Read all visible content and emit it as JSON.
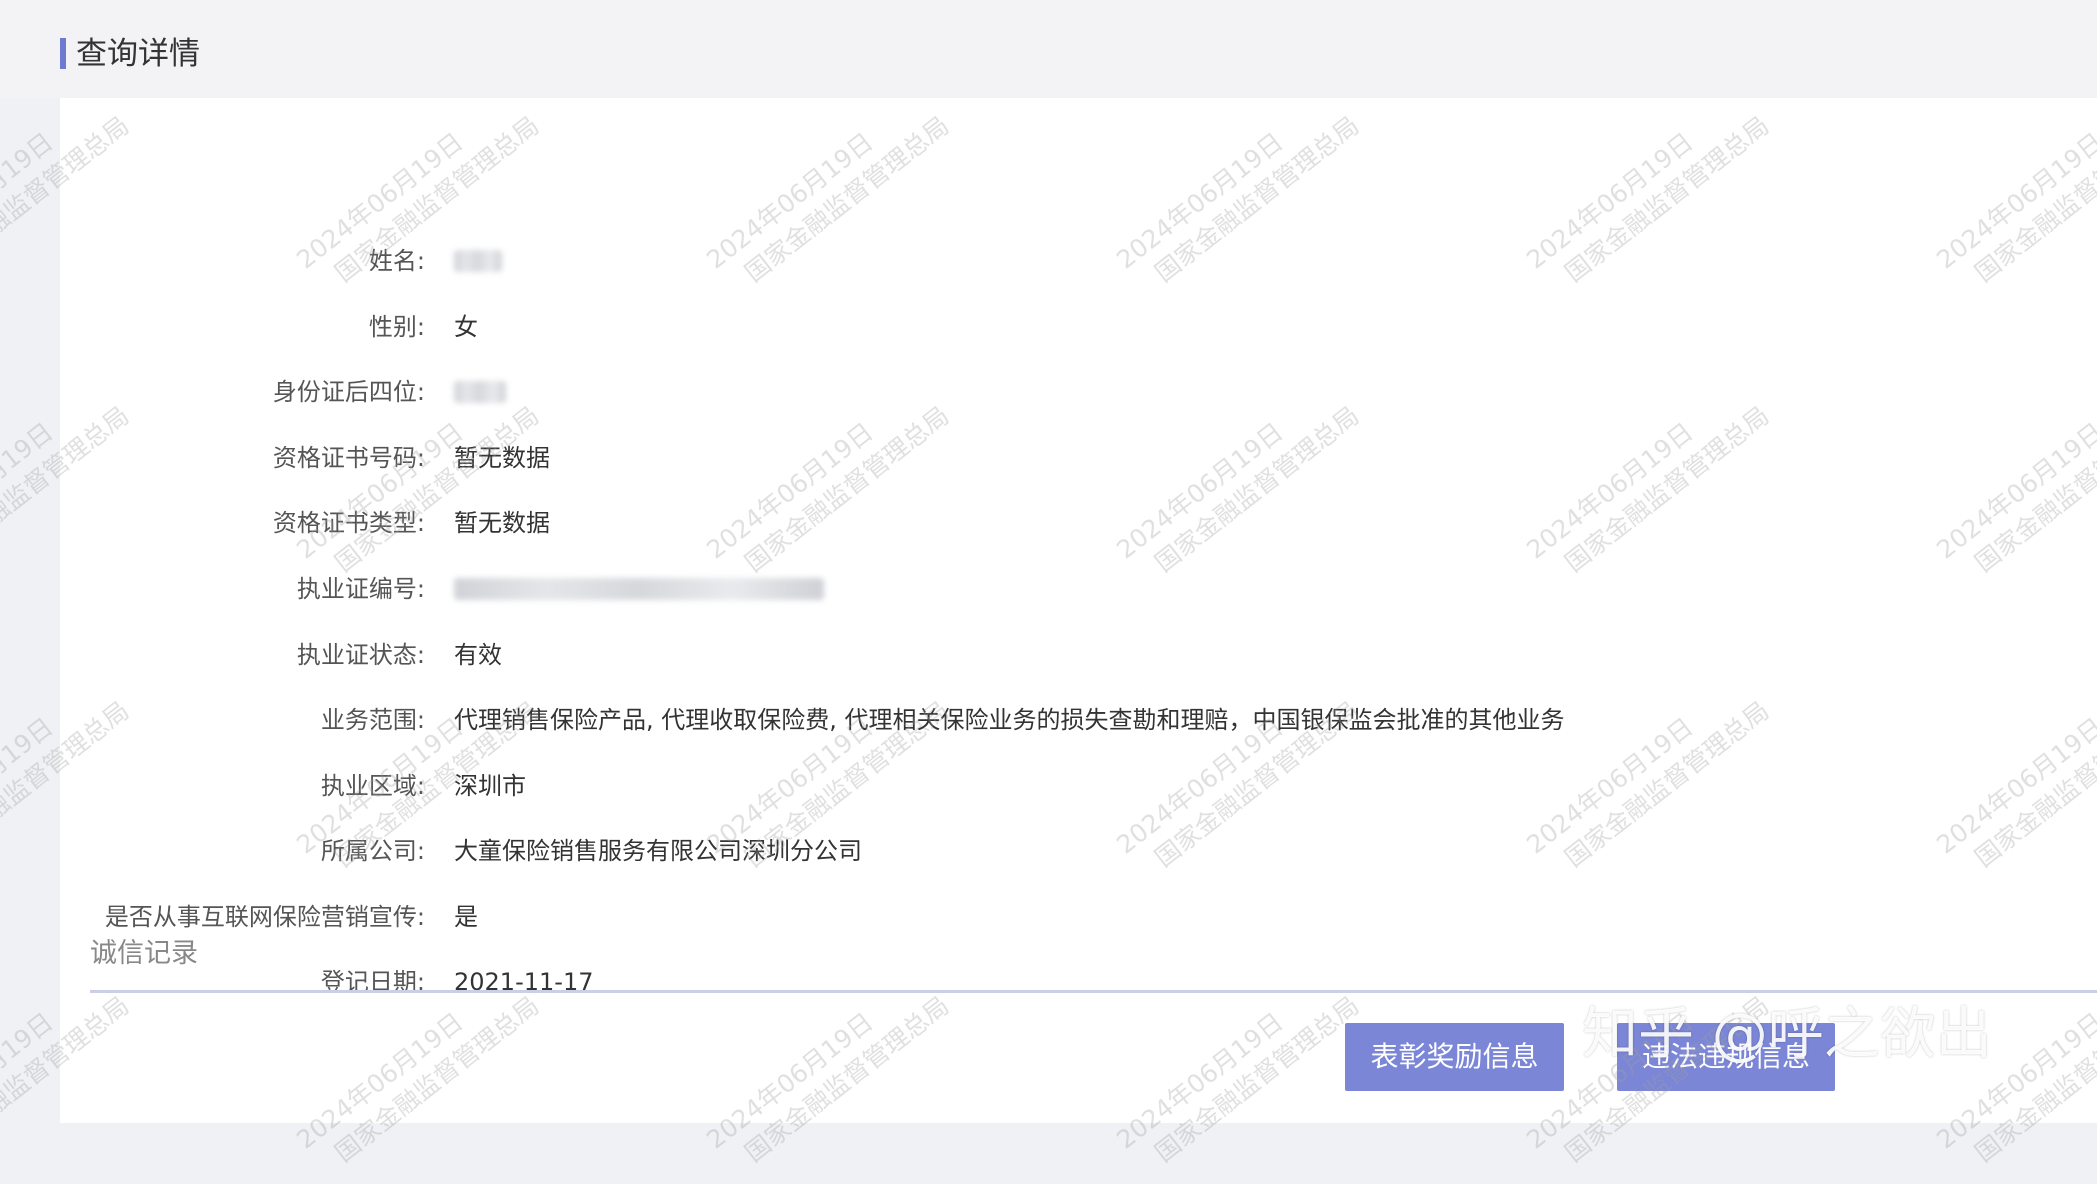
{
  "header": {
    "title": "查询详情"
  },
  "fields": [
    {
      "label": "姓名:",
      "value": "",
      "blurred": true
    },
    {
      "label": "性别:",
      "value": "女",
      "blurred": false
    },
    {
      "label": "身份证后四位:",
      "value": "",
      "blurred": true
    },
    {
      "label": "资格证书号码:",
      "value": "暂无数据",
      "blurred": false
    },
    {
      "label": "资格证书类型:",
      "value": "暂无数据",
      "blurred": false
    },
    {
      "label": "执业证编号:",
      "value": "",
      "blurred": true
    },
    {
      "label": "执业证状态:",
      "value": "有效",
      "blurred": false
    },
    {
      "label": "业务范围:",
      "value": "代理销售保险产品, 代理收取保险费, 代理相关保险业务的损失查勘和理赔，中国银保监会批准的其他业务",
      "blurred": false
    },
    {
      "label": "执业区域:",
      "value": "深圳市",
      "blurred": false
    },
    {
      "label": "所属公司:",
      "value": "大童保险销售服务有限公司深圳分公司",
      "blurred": false
    },
    {
      "label": "是否从事互联网保险营销宣传:",
      "value": "是",
      "blurred": false
    },
    {
      "label": "登记日期:",
      "value": "2021-11-17",
      "blurred": false
    }
  ],
  "credit": {
    "title": "诚信记录",
    "buttons": {
      "award_label": "表彰奖励信息",
      "violation_label": "违法违规信息"
    }
  },
  "watermark": {
    "line1": "2024年06月19日",
    "line2": "国家金融监督管理总局"
  },
  "overlay": {
    "text": "知乎 @呼之欲出"
  },
  "colors": {
    "accent": "#6e7ad0",
    "button": "#7b86d6",
    "background": "#f0f1f4"
  }
}
